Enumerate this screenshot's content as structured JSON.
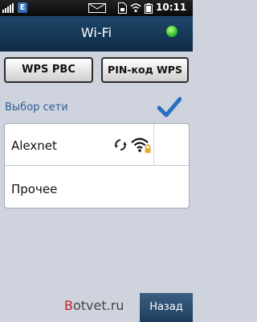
{
  "status_bar": {
    "network_badge": "E",
    "time": "10:11",
    "icons": [
      "signal-icon",
      "edge-icon",
      "envelope-icon",
      "sim-icon",
      "wifi-icon",
      "battery-icon"
    ]
  },
  "header": {
    "title": "Wi-Fi",
    "status_led_color": "#31c02c"
  },
  "buttons": {
    "wps_pbc": "WPS PBC",
    "pin_wps": "PIN-код WPS"
  },
  "section": {
    "title": "Выбор сети",
    "checked": true
  },
  "networks": [
    {
      "name": "Alexnet",
      "secured": true,
      "icons": [
        "sync-icon",
        "wifi-signal-lock-icon"
      ]
    },
    {
      "name": "Прочее"
    }
  ],
  "footer": {
    "watermark_prefix": "B",
    "watermark_rest": "otvet.ru",
    "back_label": "Назад"
  },
  "colors": {
    "title_bar": "#1e4668",
    "accent_blue": "#2d5e97",
    "background": "#cfd3dd"
  }
}
